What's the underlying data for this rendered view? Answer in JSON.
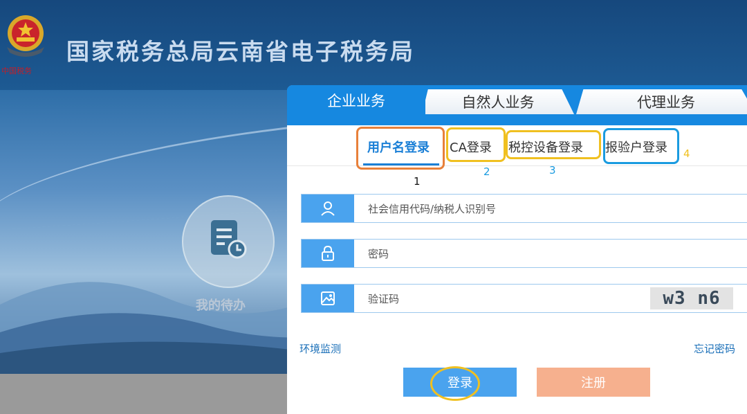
{
  "header": {
    "title": "国家税务总局云南省电子税务局",
    "seal_text": "中国税务"
  },
  "sidebar": {
    "todo_label": "我的待办"
  },
  "tabs": [
    {
      "label": "企业业务",
      "active": true
    },
    {
      "label": "自然人业务",
      "active": false
    },
    {
      "label": "代理业务",
      "active": false
    }
  ],
  "login_methods": [
    {
      "label": "用户名登录",
      "active": true,
      "annotation": "1"
    },
    {
      "label": "CA登录",
      "active": false,
      "annotation": "2"
    },
    {
      "label": "税控设备登录",
      "active": false,
      "annotation": "3"
    },
    {
      "label": "报验户登录",
      "active": false,
      "annotation": "4"
    }
  ],
  "form": {
    "taxpayer_placeholder": "社会信用代码/纳税人识别号",
    "password_placeholder": "密码",
    "captcha_placeholder": "验证码",
    "captcha_text": "w3 n6"
  },
  "links": {
    "env_check": "环境监测",
    "forgot_password": "忘记密码"
  },
  "buttons": {
    "login": "登录",
    "register": "注册"
  },
  "colors": {
    "primary": "#1688e0",
    "field_icon": "#4aa3ee",
    "register": "#f6b08e",
    "mark_orange": "#e8803a",
    "mark_yellow": "#f0c020",
    "mark_blue": "#1a9be0"
  }
}
